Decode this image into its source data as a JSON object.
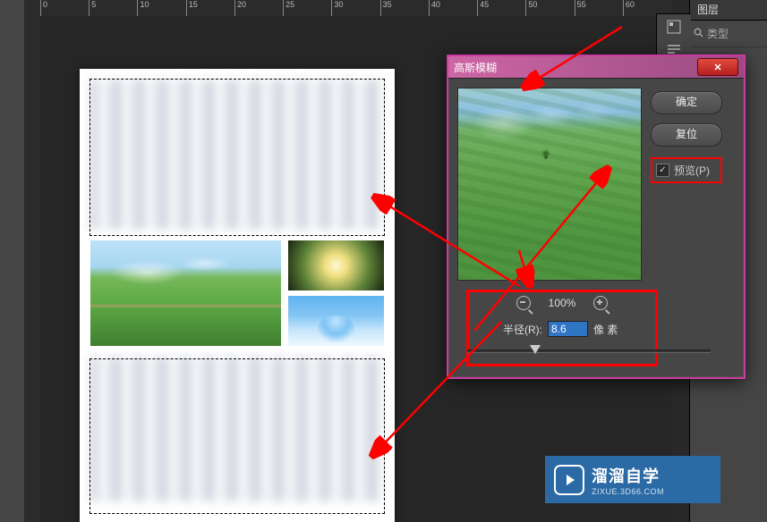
{
  "ruler": {
    "marks": [
      "0",
      "5",
      "10",
      "15",
      "20",
      "25",
      "30",
      "35",
      "40",
      "45",
      "50",
      "55",
      "60"
    ]
  },
  "layers_panel": {
    "tab": "图层",
    "search_placeholder": "类型"
  },
  "dialog": {
    "title": "高斯模糊",
    "ok": "确定",
    "cancel": "复位",
    "preview_label": "预览(P)",
    "zoom_value": "100%",
    "radius_label": "半径(R):",
    "radius_value": "8.6",
    "radius_unit": "像  素"
  },
  "watermark": {
    "name": "溜溜自学",
    "url": "ZIXUE.3D66.COM"
  }
}
